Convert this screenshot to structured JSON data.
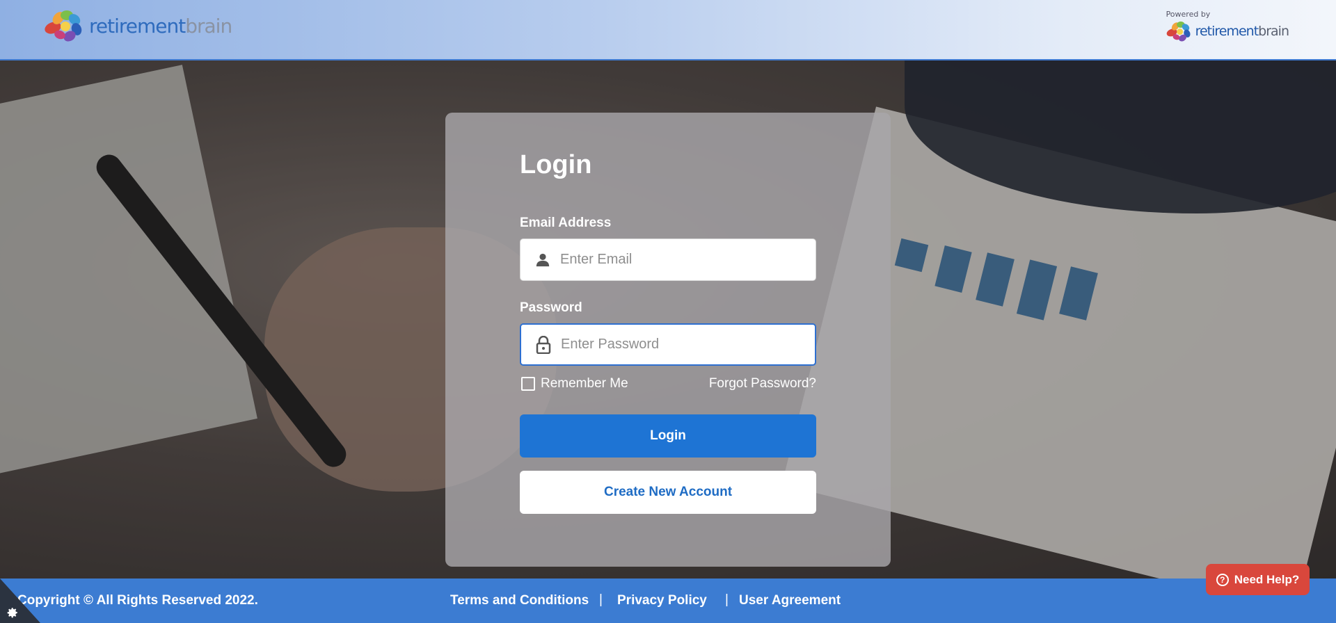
{
  "header": {
    "brand_part1": "retirement",
    "brand_part2": "brain",
    "powered_label": "Powered by"
  },
  "login": {
    "title": "Login",
    "email_label": "Email Address",
    "email_placeholder": "Enter Email",
    "email_icon": "user-icon",
    "password_label": "Password",
    "password_placeholder": "Enter Password",
    "password_icon": "lock-icon",
    "remember_label": "Remember Me",
    "remember_checked": false,
    "forgot_label": "Forgot Password?",
    "login_button": "Login",
    "create_button": "Create New Account"
  },
  "help": {
    "label": "Need Help?",
    "icon": "question-circle-icon"
  },
  "footer": {
    "copyright": "Copyright © All Rights Reserved 2022.",
    "links": [
      "Terms and Conditions",
      "Privacy Policy",
      "User Agreement"
    ],
    "separator": "|"
  },
  "colors": {
    "primary": "#1e74d4",
    "footer": "#3c7cd2",
    "help": "#d9473c"
  }
}
